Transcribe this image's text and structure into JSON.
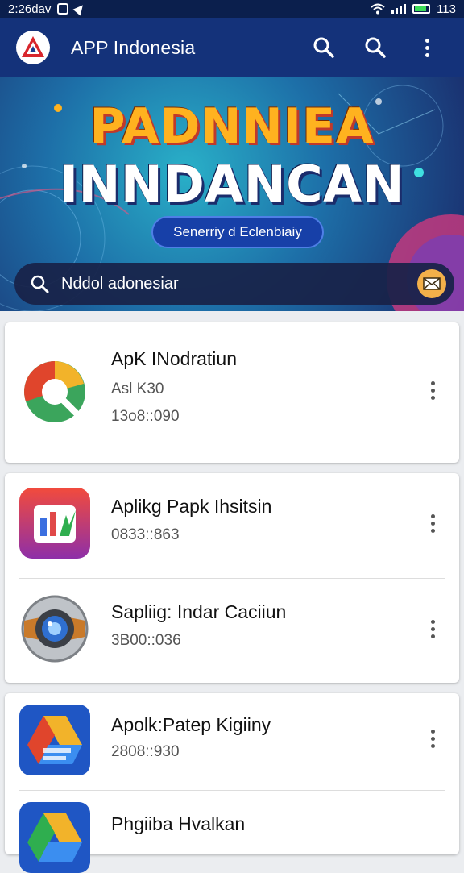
{
  "status_bar": {
    "time": "2:26dav",
    "battery": "113"
  },
  "app_bar": {
    "title": "APP Indonesia"
  },
  "banner": {
    "title_line1": "PADNNIEA",
    "title_line2": "INNDANCAN",
    "pill_label": "Senerriy d Eclenbiaiy"
  },
  "search": {
    "text": "Nddol adonesiar"
  },
  "apps": [
    {
      "name": "ApK INodratiun",
      "line1": "Asl K30",
      "line2": "13o8::090"
    },
    {
      "name": "Aplikg Papk Ihsitsin",
      "line1": "0833::863"
    },
    {
      "name": "Sapliig: Indar Caciiun",
      "line1": "3B00::036"
    },
    {
      "name": "Apolk:Patep Kigiiny",
      "line1": "2808::930"
    },
    {
      "name": "Phgiiba Hvalkan"
    }
  ],
  "colors": {
    "status_bar": "#0b1f4d",
    "app_bar": "#14327a",
    "banner_pill": "#1740a8",
    "search_bar": "#182248",
    "accent_orange": "#ffb21f",
    "background": "#ebedf0"
  },
  "icons": [
    "search-icon",
    "more-vert-icon",
    "mail-icon",
    "wifi-icon",
    "battery-icon"
  ]
}
